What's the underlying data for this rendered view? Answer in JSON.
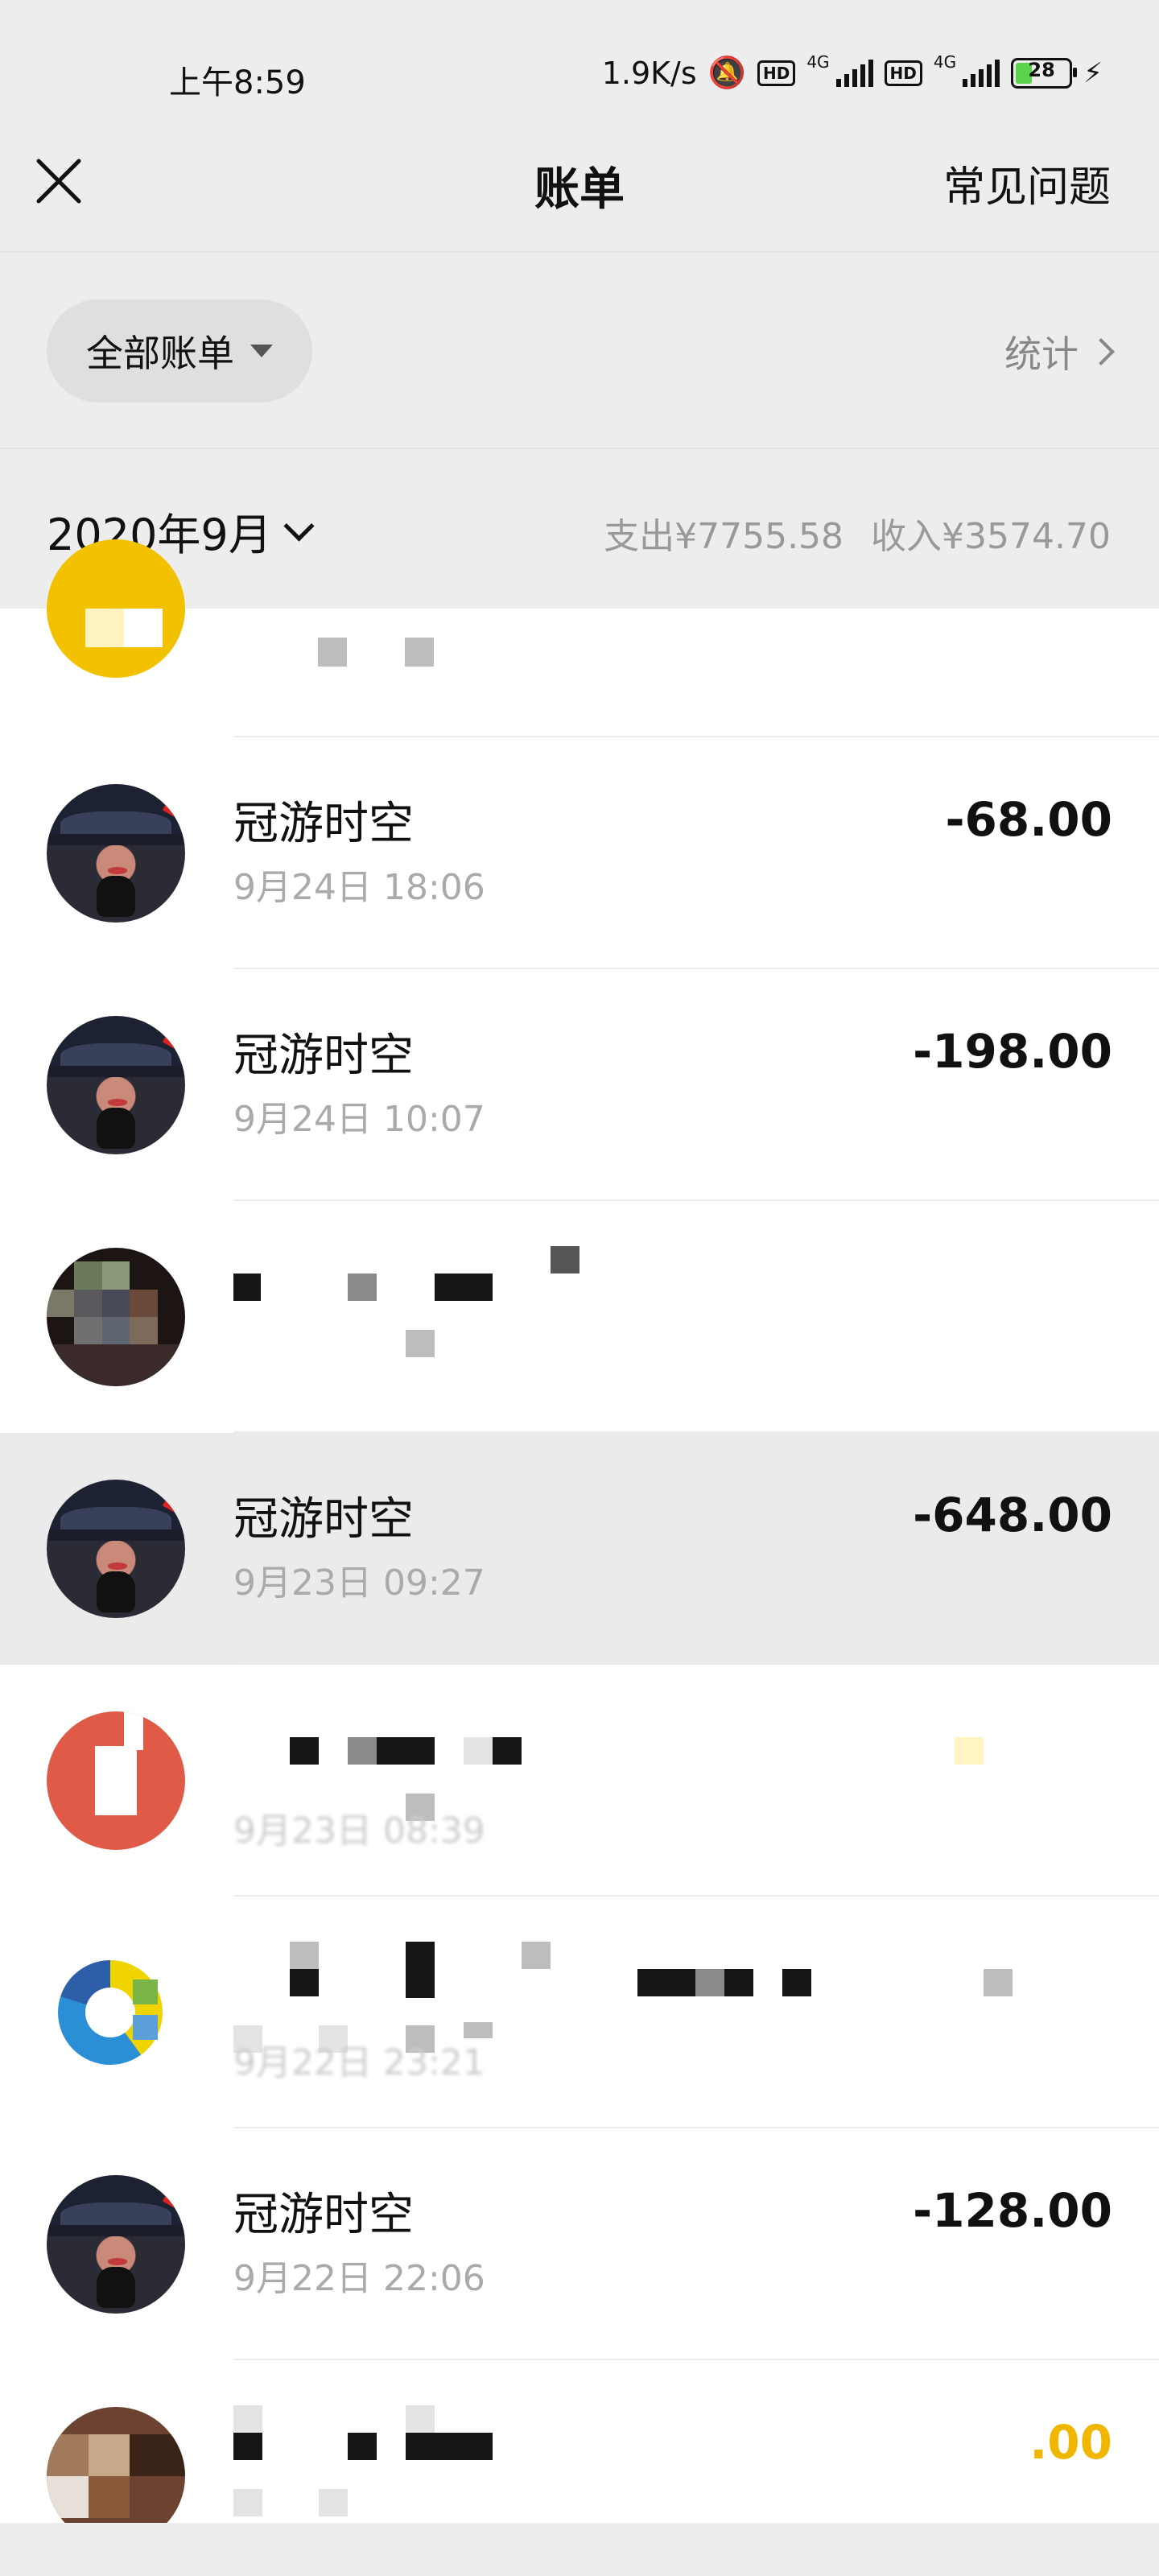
{
  "status_bar": {
    "time": "上午8:59",
    "network_speed": "1.9K/s",
    "hd_badge": "HD",
    "signal_label": "4G",
    "battery_level": "28"
  },
  "nav": {
    "title": "账单",
    "right_link": "常见问题"
  },
  "filter": {
    "selector_label": "全部账单",
    "stats_label": "统计"
  },
  "month_header": {
    "month": "2020年9月",
    "expense": "支出¥7755.58",
    "income": "收入¥3574.70"
  },
  "transactions": [
    {
      "name": "冠游时空",
      "time": "9月24日 18:06",
      "amount": "-68.00"
    },
    {
      "name": "冠游时空",
      "time": "9月24日 10:07",
      "amount": "-198.00"
    },
    {
      "name": "冠游时空",
      "time": "9月23日 09:27",
      "amount": "-648.00"
    },
    {
      "name": "冠游时空",
      "time": "9月22日 22:06",
      "amount": "-128.00"
    }
  ],
  "partial_texts": {
    "obscured_time_1": "9月23日 08:39",
    "obscured_time_2": "9月22日 23:21",
    "obscured_amount": ".00"
  },
  "colors": {
    "background": "#ededed",
    "income_accent": "#f0b600",
    "muted_text": "#aaaaaa"
  }
}
